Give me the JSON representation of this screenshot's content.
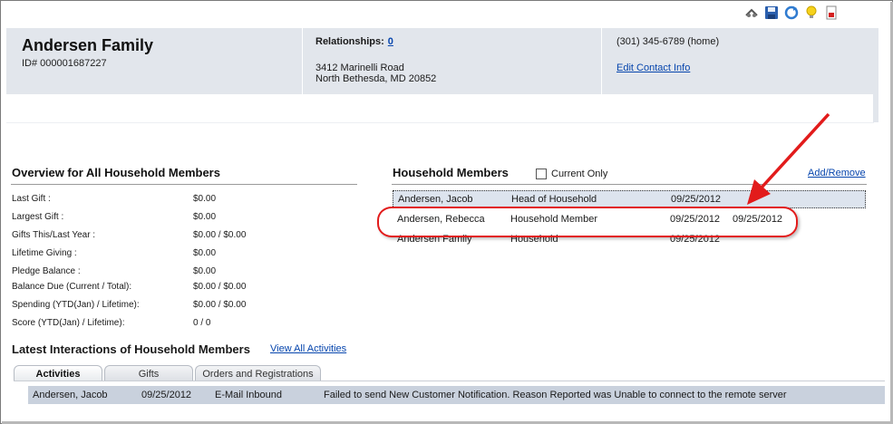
{
  "toolbar": {
    "icons": [
      "view-icon",
      "save-icon",
      "refresh-icon",
      "lightbulb-icon",
      "report-icon"
    ]
  },
  "header": {
    "family_name": "Andersen Family",
    "id_text": "ID# 000001687227",
    "relationships_label": "Relationships:",
    "relationships_count": "0",
    "address_line1": "3412 Marinelli Road",
    "address_line2": "North Bethesda, MD 20852",
    "phone": "(301) 345-6789 (home)",
    "edit_contact": "Edit Contact Info"
  },
  "overview": {
    "title": "Overview for All Household Members",
    "rows": [
      {
        "label": "Last Gift :",
        "value": "$0.00"
      },
      {
        "label": "Largest Gift :",
        "value": "$0.00"
      },
      {
        "label": "Gifts This/Last Year :",
        "value": "$0.00 / $0.00"
      },
      {
        "label": "Lifetime Giving :",
        "value": "$0.00"
      },
      {
        "label": "Pledge Balance :",
        "value": "$0.00"
      },
      {
        "label": "Balance Due (Current / Total):",
        "value": "$0.00 / $0.00"
      },
      {
        "label": "Spending (YTD(Jan) / Lifetime):",
        "value": "$0.00 / $0.00"
      },
      {
        "label": "Score (YTD(Jan) / Lifetime):",
        "value": "0 / 0"
      }
    ]
  },
  "household": {
    "title": "Household Members",
    "current_only": "Current Only",
    "add_remove": "Add/Remove",
    "members": [
      {
        "name": "Andersen, Jacob",
        "role": "Head of Household",
        "start": "09/25/2012",
        "end": ""
      },
      {
        "name": "Andersen, Rebecca",
        "role": "Household Member",
        "start": "09/25/2012",
        "end": "09/25/2012"
      },
      {
        "name": "Andersen Family",
        "role": "Household",
        "start": "09/25/2012",
        "end": ""
      }
    ]
  },
  "interactions": {
    "title": "Latest Interactions of Household Members",
    "view_all": "View All Activities",
    "tabs": [
      "Activities",
      "Gifts",
      "Orders and Registrations"
    ],
    "rows": [
      {
        "name": "Andersen, Jacob",
        "date": "09/25/2012",
        "type": "E-Mail Inbound",
        "description": "Failed to send New Customer Notification. Reason Reported was Unable to connect to the remote server"
      }
    ]
  },
  "colors": {
    "header_bg": "#e2e6ec",
    "link": "#0645ad",
    "callout_red": "#e21b1b",
    "row_highlight": "#c9d1dd"
  }
}
